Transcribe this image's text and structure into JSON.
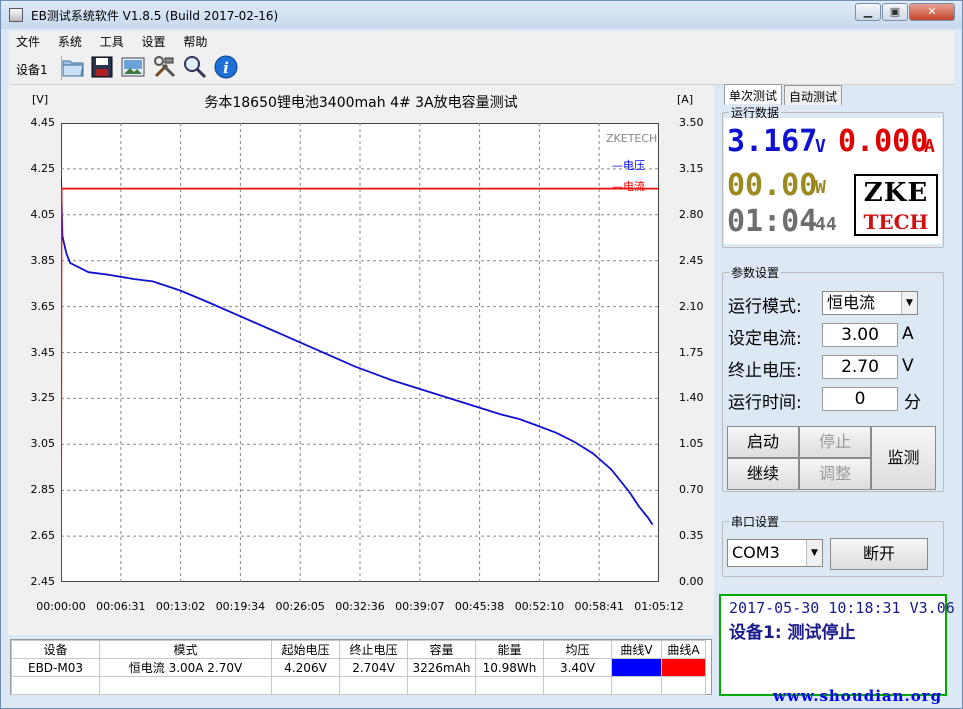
{
  "window": {
    "title": "EB测试系统软件 V1.8.5 (Build 2017-02-16)",
    "buttons": {
      "minimize": "▁",
      "restore": "▣",
      "close": "✕"
    }
  },
  "menu": [
    "文件",
    "系统",
    "工具",
    "设置",
    "帮助"
  ],
  "toolbar": {
    "device_label": "设备1",
    "icons": [
      "open-folder-icon",
      "save-icon",
      "image-icon",
      "tools-icon",
      "magnifier-icon",
      "info-icon"
    ]
  },
  "chart_data": {
    "type": "line",
    "title": "务本18650锂电池3400mah 4# 3A放电容量测试",
    "left_unit": "[V]",
    "right_unit": "[A]",
    "watermark": "ZKETECH",
    "y_left_ticks": [
      "4.45",
      "4.25",
      "4.05",
      "3.85",
      "3.65",
      "3.45",
      "3.25",
      "3.05",
      "2.85",
      "2.65",
      "2.45"
    ],
    "y_right_ticks": [
      "3.50",
      "3.15",
      "2.80",
      "2.45",
      "2.10",
      "1.75",
      "1.40",
      "1.05",
      "0.70",
      "0.35",
      "0.00"
    ],
    "x_ticks": [
      "00:00:00",
      "00:06:31",
      "00:13:02",
      "00:19:34",
      "00:26:05",
      "00:32:36",
      "00:39:07",
      "00:45:38",
      "00:52:10",
      "00:58:41",
      "01:05:12"
    ],
    "ylim_left": [
      2.45,
      4.45
    ],
    "ylim_right": [
      0.0,
      3.5
    ],
    "xlim_minutes": [
      0,
      65.2
    ],
    "series": [
      {
        "name": "电压",
        "color": "#1010d0",
        "axis": "left",
        "x_minutes": [
          0,
          0.15,
          0.3,
          0.6,
          1,
          2,
          3,
          5,
          8,
          10,
          13,
          16,
          20,
          24,
          28,
          32,
          36,
          40,
          44,
          48,
          50,
          52,
          54,
          56,
          58,
          60,
          62,
          63,
          64,
          64.5
        ],
        "y": [
          4.21,
          3.96,
          3.93,
          3.88,
          3.84,
          3.82,
          3.8,
          3.79,
          3.77,
          3.76,
          3.72,
          3.67,
          3.6,
          3.53,
          3.46,
          3.39,
          3.33,
          3.28,
          3.23,
          3.18,
          3.16,
          3.13,
          3.1,
          3.06,
          3.01,
          2.94,
          2.84,
          2.78,
          2.73,
          2.7
        ]
      },
      {
        "name": "电流",
        "color": "#e81010",
        "axis": "right",
        "x_minutes": [
          0,
          0.05,
          64.6,
          65.2
        ],
        "y": [
          0.0,
          3.0,
          3.0,
          3.0
        ]
      }
    ],
    "grid": true,
    "legend_placement": "top-right"
  },
  "summary_table": {
    "headers": [
      "设备",
      "模式",
      "起始电压",
      "终止电压",
      "容量",
      "能量",
      "均压",
      "曲线V",
      "曲线A"
    ],
    "row": [
      "EBD-M03",
      "恒电流  3.00A  2.70V",
      "4.206V",
      "2.704V",
      "3226mAh",
      "10.98Wh",
      "3.40V"
    ],
    "curve_colors": [
      "#0000ff",
      "#ff0000"
    ]
  },
  "tabs": [
    "单次测试",
    "自动测试"
  ],
  "run_data": {
    "group_title": "运行数据",
    "voltage": "3.167",
    "voltage_unit": "V",
    "current": "0.000",
    "current_unit": "A",
    "power": "00.00",
    "power_unit": "W",
    "time": "01:04",
    "time_seconds": "44",
    "logo_top": "ZKE",
    "logo_bottom": "TECH"
  },
  "params": {
    "group_title": "参数设置",
    "mode_label": "运行模式:",
    "mode_value": "恒电流",
    "current_label": "设定电流:",
    "current_value": "3.00",
    "current_unit": "A",
    "cutoff_label": "终止电压:",
    "cutoff_value": "2.70",
    "cutoff_unit": "V",
    "runtime_label": "运行时间:",
    "runtime_value": "0",
    "runtime_unit": "分"
  },
  "controls": {
    "start": "启动",
    "stop": "停止",
    "continue": "继续",
    "adjust": "调整",
    "monitor": "监测"
  },
  "serial": {
    "group_title": "串口设置",
    "port": "COM3",
    "disconnect": "断开"
  },
  "status": {
    "line1": "2017-05-30 10:18:31  V3.06",
    "line2": "设备1: 测试停止"
  },
  "watermark_site": "www.shoudian.org"
}
